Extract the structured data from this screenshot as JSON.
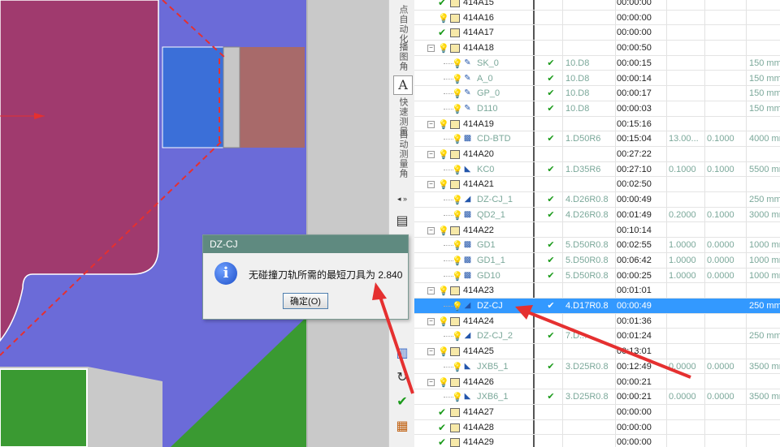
{
  "dialog": {
    "title": "DZ-CJ",
    "message": "无碰撞刀轨所需的最短刀具为 2.840",
    "ok_label": "确定(O)",
    "icon": "info-icon"
  },
  "side_strip": {
    "labels": [
      "点自动化",
      "播图角",
      "快速测量",
      "自动测量角"
    ],
    "icons": [
      "measure-a-icon",
      "collapse-icon",
      "chevron-down-icon",
      "layers-icon"
    ]
  },
  "tree": {
    "rows": [
      {
        "type": "group",
        "name": "414A15",
        "status": "check",
        "time": "00:00:00"
      },
      {
        "type": "group",
        "name": "414A16",
        "status": "bulb",
        "time": "00:00:00"
      },
      {
        "type": "group",
        "name": "414A17",
        "status": "check",
        "time": "00:00:00"
      },
      {
        "type": "group",
        "name": "414A18",
        "status": "bulb",
        "time": "00:00:50",
        "expandable": true
      },
      {
        "type": "op",
        "name": "SK_0",
        "op_icon": "profile-op-icon",
        "check": "✔",
        "tool": "10.D8",
        "time": "00:00:15",
        "c": "150 mm"
      },
      {
        "type": "op",
        "name": "A_0",
        "op_icon": "profile-op-icon",
        "check": "✔",
        "tool": "10.D8",
        "time": "00:00:14",
        "c": "150 mm"
      },
      {
        "type": "op",
        "name": "GP_0",
        "op_icon": "profile-op-icon",
        "check": "✔",
        "tool": "10.D8",
        "time": "00:00:17",
        "c": "150 mm"
      },
      {
        "type": "op",
        "name": "D110",
        "op_icon": "profile-op-icon",
        "check": "✔",
        "tool": "10.D8",
        "time": "00:00:03",
        "c": "150 mm"
      },
      {
        "type": "group",
        "name": "414A19",
        "status": "bulb",
        "time": "00:15:16",
        "expandable": true
      },
      {
        "type": "op",
        "name": "CD-BTD",
        "op_icon": "cavity-op-icon",
        "check": "✔",
        "tool": "1.D50R6",
        "time": "00:15:04",
        "a": "13.00...",
        "b": "0.1000",
        "c": "4000 mm"
      },
      {
        "type": "group",
        "name": "414A20",
        "status": "bulb",
        "time": "00:27:22",
        "expandable": true
      },
      {
        "type": "op",
        "name": "KC0",
        "op_icon": "zlevel-op-icon",
        "check": "✔",
        "tool": "1.D35R6",
        "time": "00:27:10",
        "a": "0.1000",
        "b": "0.1000",
        "c": "5500 mm"
      },
      {
        "type": "group",
        "name": "414A21",
        "status": "bulb",
        "time": "00:02:50",
        "expandable": true
      },
      {
        "type": "op",
        "name": "DZ-CJ_1",
        "op_icon": "contour-op-icon",
        "check": "✔",
        "tool": "4.D26R0.8",
        "time": "00:00:49",
        "c": "250 mm"
      },
      {
        "type": "op",
        "name": "QD2_1",
        "op_icon": "cavity-op-icon",
        "check": "✔",
        "tool": "4.D26R0.8",
        "time": "00:01:49",
        "a": "0.2000",
        "b": "0.1000",
        "c": "3000 mm"
      },
      {
        "type": "group",
        "name": "414A22",
        "status": "bulb",
        "time": "00:10:14",
        "expandable": true
      },
      {
        "type": "op",
        "name": "GD1",
        "op_icon": "cavity-op-icon",
        "check": "✔",
        "tool": "5.D50R0.8",
        "time": "00:02:55",
        "a": "1.0000",
        "b": "0.0000",
        "c": "1000 mm"
      },
      {
        "type": "op",
        "name": "GD1_1",
        "op_icon": "cavity-op-icon",
        "check": "✔",
        "tool": "5.D50R0.8",
        "time": "00:06:42",
        "a": "1.0000",
        "b": "0.0000",
        "c": "1000 mm"
      },
      {
        "type": "op",
        "name": "GD10",
        "op_icon": "cavity-op-icon",
        "check": "✔",
        "tool": "5.D50R0.8",
        "time": "00:00:25",
        "a": "1.0000",
        "b": "0.0000",
        "c": "1000 mm"
      },
      {
        "type": "group",
        "name": "414A23",
        "status": "bulb",
        "time": "00:01:01",
        "expandable": true
      },
      {
        "type": "op",
        "name": "DZ-CJ",
        "op_icon": "contour-op-icon",
        "check": "✔",
        "tool": "4.D17R0.8",
        "time": "00:00:49",
        "c": "250 mm",
        "selected": true
      },
      {
        "type": "group",
        "name": "414A24",
        "status": "bulb",
        "time": "00:01:36",
        "expandable": true
      },
      {
        "type": "op",
        "name": "DZ-CJ_2",
        "op_icon": "contour-op-icon",
        "check": "✔",
        "tool": "7.D...",
        "time": "00:01:24",
        "c": "250 mm"
      },
      {
        "type": "group",
        "name": "414A25",
        "status": "bulb",
        "time": "00:13:01",
        "expandable": true
      },
      {
        "type": "op",
        "name": "JXB5_1",
        "op_icon": "zlevel-op-icon",
        "check": "✔",
        "tool": "3.D25R0.8",
        "time": "00:12:49",
        "a": "0.0000",
        "b": "0.0000",
        "c": "3500 mm"
      },
      {
        "type": "group",
        "name": "414A26",
        "status": "bulb",
        "time": "00:00:21",
        "expandable": true
      },
      {
        "type": "op",
        "name": "JXB6_1",
        "op_icon": "zlevel-op-icon",
        "check": "✔",
        "tool": "3.D25R0.8",
        "time": "00:00:21",
        "a": "0.0000",
        "b": "0.0000",
        "c": "3500 mm"
      },
      {
        "type": "group",
        "name": "414A27",
        "status": "check",
        "time": "00:00:00"
      },
      {
        "type": "group",
        "name": "414A28",
        "status": "check",
        "time": "00:00:00"
      },
      {
        "type": "group",
        "name": "414A29",
        "status": "check",
        "time": "00:00:00"
      }
    ]
  },
  "colors": {
    "part_magenta": "#a03a6e",
    "part_purple": "#6b6bd8",
    "pocket_blue": "#3b6fd8",
    "brown": "#a86a6a",
    "green": "#3a9a32",
    "selection": "#3399ff",
    "annotation_red": "#e53030"
  }
}
